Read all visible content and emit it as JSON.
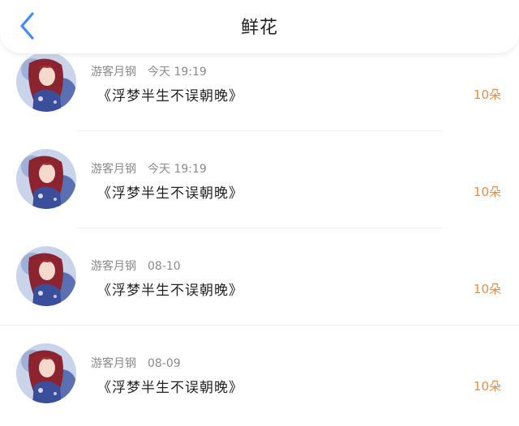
{
  "header": {
    "title": "鲜花",
    "accent_color": "#3d8bfd"
  },
  "items": [
    {
      "user": "游客月钢",
      "time": "今天 19:19",
      "message": "《浮梦半生不误朝晚》",
      "count": "10朵"
    },
    {
      "user": "游客月钢",
      "time": "今天 19:19",
      "message": "《浮梦半生不误朝晚》",
      "count": "10朵"
    },
    {
      "user": "游客月钢",
      "time": "08-10",
      "message": "《浮梦半生不误朝晚》",
      "count": "10朵"
    },
    {
      "user": "游客月钢",
      "time": "08-09",
      "message": "《浮梦半生不误朝晚》",
      "count": "10朵"
    }
  ]
}
